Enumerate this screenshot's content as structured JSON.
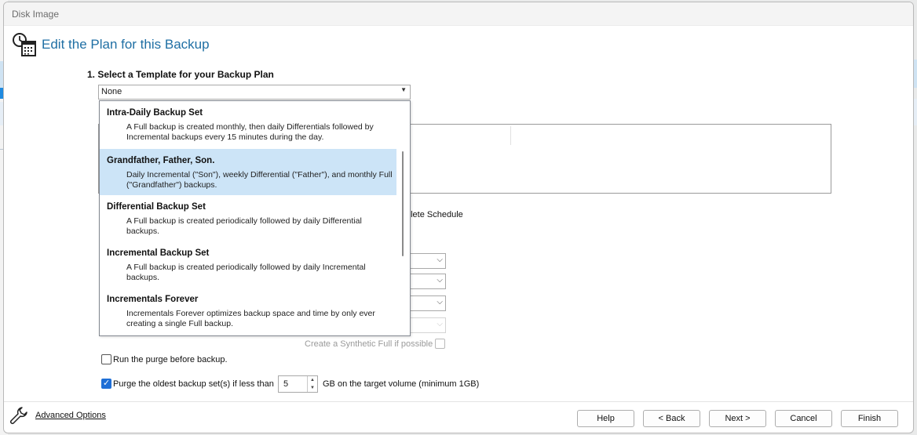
{
  "window": {
    "title": "Disk Image"
  },
  "header": {
    "title": "Edit the Plan for this Backup"
  },
  "step1": {
    "label": "1. Select a Template for your Backup Plan"
  },
  "template_combo": {
    "value": "None"
  },
  "dropdown": {
    "items": [
      {
        "title": "Intra-Daily Backup Set",
        "desc": "A Full backup is created monthly, then daily Differentials followed by Incremental backups every 15 minutes during the day."
      },
      {
        "title": "Grandfather, Father, Son.",
        "desc": "Daily Incremental (\"Son\"), weekly Differential (\"Father\"), and monthly Full (\"Grandfather\") backups."
      },
      {
        "title": "Differential Backup Set",
        "desc": "A Full backup is created periodically followed by daily Differential backups."
      },
      {
        "title": "Incremental Backup Set",
        "desc": "A Full backup is created periodically followed by daily Incremental backups."
      },
      {
        "title": "Incrementals Forever",
        "desc": "Incrementals Forever optimizes backup space and time by only ever creating a single Full backup."
      }
    ],
    "selected_index": 1
  },
  "schedule": {
    "delete_label": "elete Schedule"
  },
  "synthetic": {
    "label": "Create a Synthetic Full if possible"
  },
  "purge_before": {
    "label": "Run the purge before backup.",
    "checked": false
  },
  "purge_oldest": {
    "label": "Purge the oldest backup set(s) if less than",
    "checked": true,
    "value": "5",
    "suffix": "GB on the target volume (minimum 1GB)"
  },
  "footer": {
    "advanced": "Advanced Options",
    "help": "Help",
    "back": "< Back",
    "next": "Next >",
    "cancel": "Cancel",
    "finish": "Finish"
  },
  "colors": {
    "accent": "#1f6fa4",
    "selection": "#cce4f7",
    "checkbox": "#1f6fd6"
  }
}
